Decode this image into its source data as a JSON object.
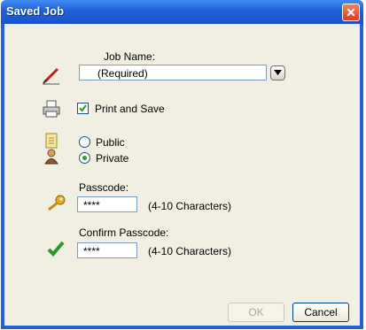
{
  "window": {
    "title": "Saved Job",
    "close_glyph": "✕"
  },
  "job_name": {
    "label": "Job Name:",
    "value": "(Required)"
  },
  "print_and_save": {
    "label": "Print and Save",
    "checked": true
  },
  "visibility": {
    "options": [
      {
        "label": "Public",
        "selected": false
      },
      {
        "label": "Private",
        "selected": true
      }
    ]
  },
  "passcode": {
    "label": "Passcode:",
    "value": "****",
    "hint": "(4-10 Characters)"
  },
  "confirm_passcode": {
    "label": "Confirm Passcode:",
    "value": "****",
    "hint": "(4-10 Characters)"
  },
  "buttons": {
    "ok": "OK",
    "cancel": "Cancel"
  },
  "icons": {
    "job_name": "pen-icon",
    "print_and_save": "printer-icon",
    "public": "document-icon",
    "private": "user-icon",
    "passcode": "key-icon",
    "confirm": "checkmark-icon"
  },
  "colors": {
    "titlebar": "#1f5fd8",
    "close": "#d8401c",
    "client": "#f1efe2"
  }
}
